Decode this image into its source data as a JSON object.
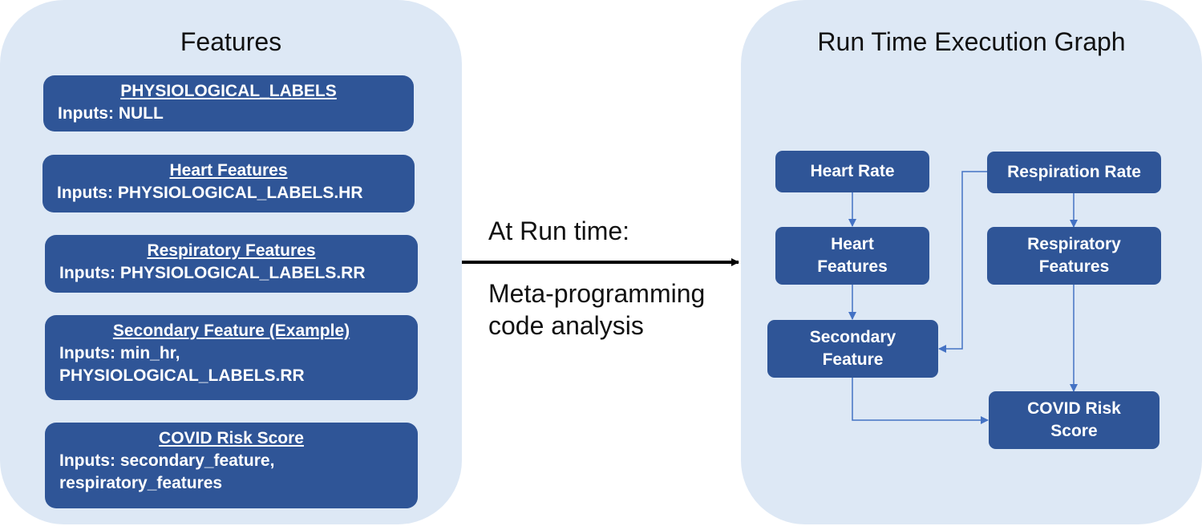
{
  "left_panel": {
    "title": "Features",
    "features": [
      {
        "name": "PHYSIOLOGICAL_LABELS",
        "inputs": "Inputs: NULL"
      },
      {
        "name": "Heart Features",
        "inputs": "Inputs: PHYSIOLOGICAL_LABELS.HR"
      },
      {
        "name": "Respiratory Features",
        "inputs": "Inputs: PHYSIOLOGICAL_LABELS.RR"
      },
      {
        "name": "Secondary Feature (Example)",
        "inputs": "Inputs: min_hr,\nPHYSIOLOGICAL_LABELS.RR"
      },
      {
        "name": "COVID Risk Score",
        "inputs": "Inputs: secondary_feature,\nrespiratory_features"
      }
    ]
  },
  "middle": {
    "top_label": "At Run time:",
    "bottom_label": "Meta-programming\ncode analysis"
  },
  "right_panel": {
    "title": "Run Time Execution Graph",
    "nodes": {
      "heart_rate": "Heart Rate",
      "respiration_rate": "Respiration Rate",
      "heart_features": "Heart\nFeatures",
      "respiratory_features": "Respiratory\nFeatures",
      "secondary_feature": "Secondary\nFeature",
      "covid_risk_score": "COVID Risk\nScore"
    },
    "edges": [
      {
        "from": "heart_rate",
        "to": "heart_features"
      },
      {
        "from": "heart_features",
        "to": "secondary_feature"
      },
      {
        "from": "respiration_rate",
        "to": "secondary_feature"
      },
      {
        "from": "respiration_rate",
        "to": "respiratory_features"
      },
      {
        "from": "respiratory_features",
        "to": "covid_risk_score"
      },
      {
        "from": "secondary_feature",
        "to": "covid_risk_score"
      }
    ]
  },
  "colors": {
    "panel_bg": "#dde8f5",
    "box_fill": "#2f5597",
    "edge": "#4472c4",
    "arrow": "#000000"
  }
}
